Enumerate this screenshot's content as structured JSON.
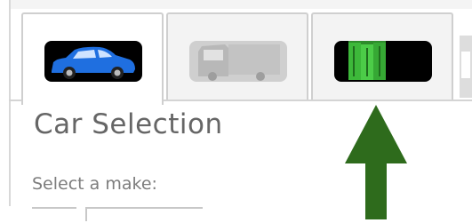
{
  "tabs": [
    {
      "name": "car",
      "icon": "car-icon",
      "state": "active"
    },
    {
      "name": "truck",
      "icon": "truck-icon",
      "state": "disabled"
    },
    {
      "name": "books",
      "icon": "binders-icon",
      "state": "normal"
    }
  ],
  "panel": {
    "title": "Car Selection",
    "make_label": "Select a make:"
  },
  "colors": {
    "arrow": "#2e6b1c",
    "car_blue": "#1f6fe0",
    "binder_green": "#3db83a"
  }
}
